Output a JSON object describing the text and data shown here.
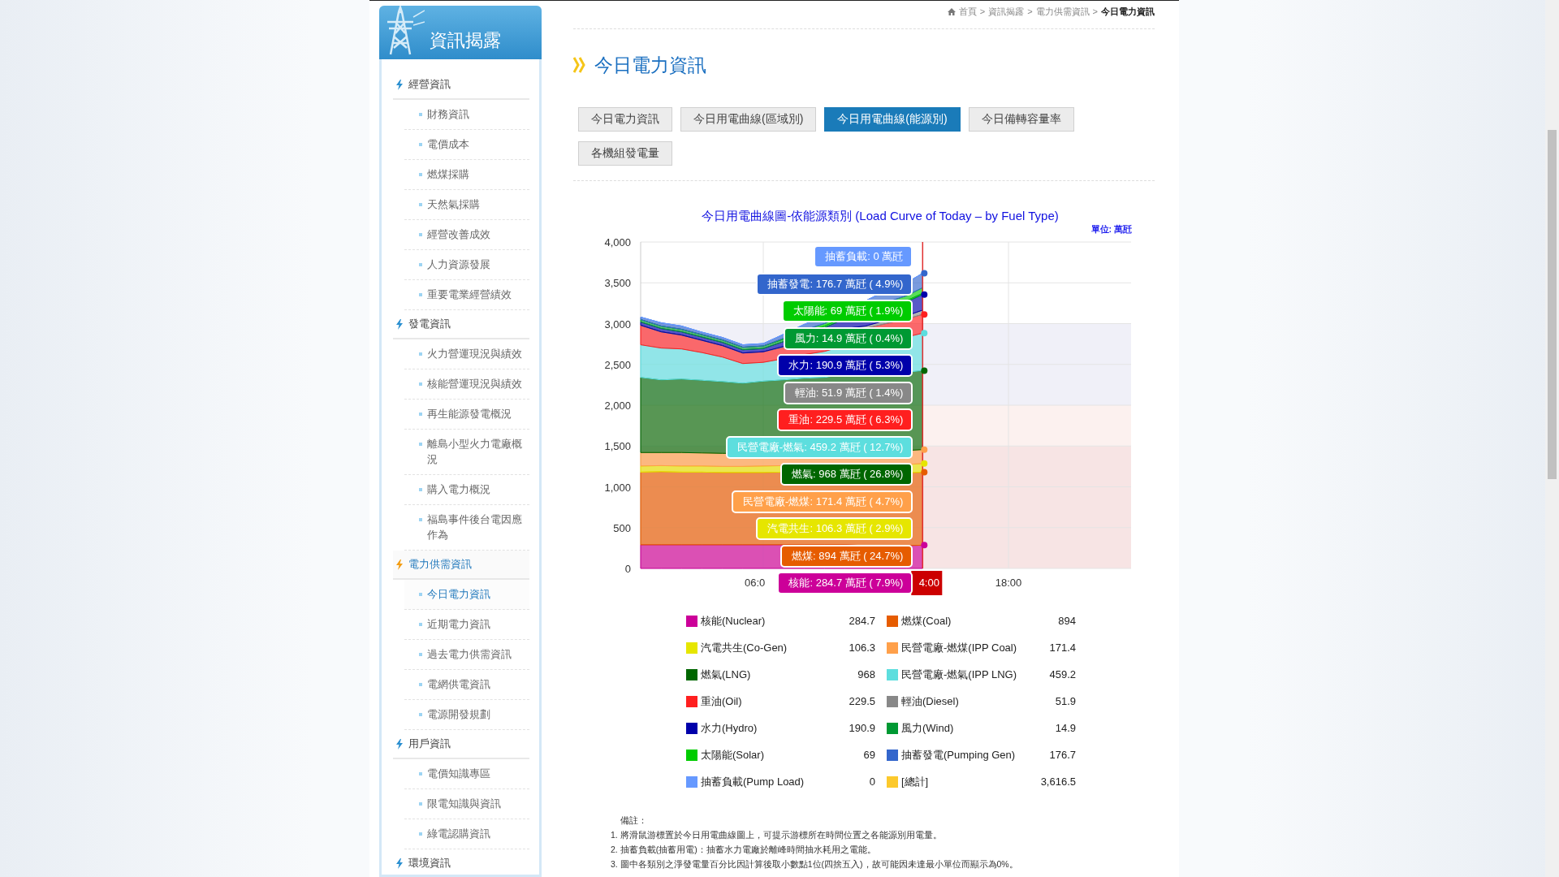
{
  "sidebar": {
    "title": "資訊揭露",
    "sections": [
      {
        "label": "經營資訊",
        "selected": false,
        "items": [
          {
            "label": "財務資訊",
            "selected": false
          },
          {
            "label": "電價成本",
            "selected": false
          },
          {
            "label": "燃煤採購",
            "selected": false
          },
          {
            "label": "天然氣採購",
            "selected": false
          },
          {
            "label": "經營改善成效",
            "selected": false
          },
          {
            "label": "人力資源發展",
            "selected": false
          },
          {
            "label": "重要電業經營績效",
            "selected": false
          }
        ]
      },
      {
        "label": "發電資訊",
        "selected": false,
        "items": [
          {
            "label": "火力營運現況與績效",
            "selected": false
          },
          {
            "label": "核能營運現況與績效",
            "selected": false
          },
          {
            "label": "再生能源發電概況",
            "selected": false
          },
          {
            "label": "離島小型火力電廠概況",
            "selected": false
          },
          {
            "label": "購入電力概況",
            "selected": false
          },
          {
            "label": "福島事件後台電因應作為",
            "selected": false
          }
        ]
      },
      {
        "label": "電力供需資訊",
        "selected": true,
        "items": [
          {
            "label": "今日電力資訊",
            "selected": true
          },
          {
            "label": "近期電力資訊",
            "selected": false
          },
          {
            "label": "過去電力供需資訊",
            "selected": false
          },
          {
            "label": "電網供電資訊",
            "selected": false
          },
          {
            "label": "電源開發規劃",
            "selected": false
          }
        ]
      },
      {
        "label": "用戶資訊",
        "selected": false,
        "items": [
          {
            "label": "電價知識專區",
            "selected": false
          },
          {
            "label": "限電知識與資訊",
            "selected": false
          },
          {
            "label": "綠電認購資訊",
            "selected": false
          }
        ]
      },
      {
        "label": "環境資訊",
        "selected": false
      }
    ]
  },
  "breadcrumb": {
    "items": [
      "首頁",
      "資訊揭露",
      "電力供需資訊",
      "今日電力資訊"
    ],
    "separators": [
      ">",
      ">",
      ">"
    ]
  },
  "page_title": "今日電力資訊",
  "tabs": [
    {
      "label": "今日電力資訊",
      "selected": false
    },
    {
      "label": "今日用電曲線(區域別)",
      "selected": false
    },
    {
      "label": "今日用電曲線(能源別)",
      "selected": true
    },
    {
      "label": "今日備轉容量率",
      "selected": false
    },
    {
      "label": "各機組發電量",
      "selected": false
    }
  ],
  "chart": {
    "title": "今日用電曲線圖-依能源類別 (Load Curve of Today – by Fuel Type)",
    "unit": "單位: 萬瓩",
    "y_axis_labels": [
      "4,000",
      "3,500",
      "3,000",
      "2,500",
      "2,000",
      "1,500",
      "1,000",
      "500",
      "0"
    ],
    "x_axis_labels": [
      "06:0",
      "18:00"
    ],
    "time_label": "4:00",
    "tooltip": [
      {
        "text": "抽蓄負載: 0 萬瓩",
        "color": "#6699ff"
      },
      {
        "text": "抽蓄發電: 176.7 萬瓩 ( 4.9%)",
        "color": "#3366cc"
      },
      {
        "text": "太陽能: 69 萬瓩 ( 1.9%)",
        "color": "#00cc00"
      },
      {
        "text": "風力: 14.9 萬瓩 ( 0.4%)",
        "color": "#009933"
      },
      {
        "text": "水力: 190.9 萬瓩 ( 5.3%)",
        "color": "#0000aa"
      },
      {
        "text": "輕油: 51.9 萬瓩 ( 1.4%)",
        "color": "#888888"
      },
      {
        "text": "重油: 229.5 萬瓩 ( 6.3%)",
        "color": "#ff1f1f"
      },
      {
        "text": "民營電廠-燃氣: 459.2 萬瓩 ( 12.7%)",
        "color": "#5ddede"
      },
      {
        "text": "燃氣: 968 萬瓩 ( 26.8%)",
        "color": "#006600"
      },
      {
        "text": "民營電廠-燃煤: 171.4 萬瓩 ( 4.7%)",
        "color": "#ffa04a"
      },
      {
        "text": "汽電共生: 106.3 萬瓩 ( 2.9%)",
        "color": "#e6e600"
      },
      {
        "text": "燃煤: 894 萬瓩 ( 24.7%)",
        "color": "#e65c00"
      },
      {
        "text": "核能: 284.7 萬瓩 ( 7.9%)",
        "color": "#cc0099"
      }
    ],
    "legend": {
      "items": [
        {
          "name": "核能(Nuclear)",
          "value": "284.7",
          "color": "#cc0099"
        },
        {
          "name": "燃煤(Coal)",
          "value": "894",
          "color": "#e65c00"
        },
        {
          "name": "汽電共生(Co-Gen)",
          "value": "106.3",
          "color": "#e6e600"
        },
        {
          "name": "民營電廠-燃煤(IPP Coal)",
          "value": "171.4",
          "color": "#ffa04a"
        },
        {
          "name": "燃氣(LNG)",
          "value": "968",
          "color": "#006600"
        },
        {
          "name": "民營電廠-燃氣(IPP LNG)",
          "value": "459.2",
          "color": "#5ddede"
        },
        {
          "name": "重油(Oil)",
          "value": "229.5",
          "color": "#ff1f1f"
        },
        {
          "name": "輕油(Diesel)",
          "value": "51.9",
          "color": "#888888"
        },
        {
          "name": "水力(Hydro)",
          "value": "190.9",
          "color": "#0000aa"
        },
        {
          "name": "風力(Wind)",
          "value": "14.9",
          "color": "#009933"
        },
        {
          "name": "太陽能(Solar)",
          "value": "69",
          "color": "#00cc00"
        },
        {
          "name": "抽蓄發電(Pumping Gen)",
          "value": "176.7",
          "color": "#3366cc"
        },
        {
          "name": "抽蓄負載(Pump Load)",
          "value": "0",
          "color": "#6699ff"
        }
      ],
      "total": {
        "name": "[總計]",
        "value": "3,616.5",
        "color": "#fcc92c"
      }
    }
  },
  "notes": {
    "heading": "備註：",
    "lines": [
      "1. 將滑鼠游標置於今日用電曲線圖上，可提示游標所在時間位置之各能源別用電量。",
      "2. 抽蓄負載(抽蓄用電)：抽蓄水力電廠於離峰時間抽水耗用之電能。",
      "3. 圖中各類別之淨發電量百分比因計算後取小數點1位(四捨五入)，故可能因未達最小單位而顯示為0%。"
    ]
  }
}
